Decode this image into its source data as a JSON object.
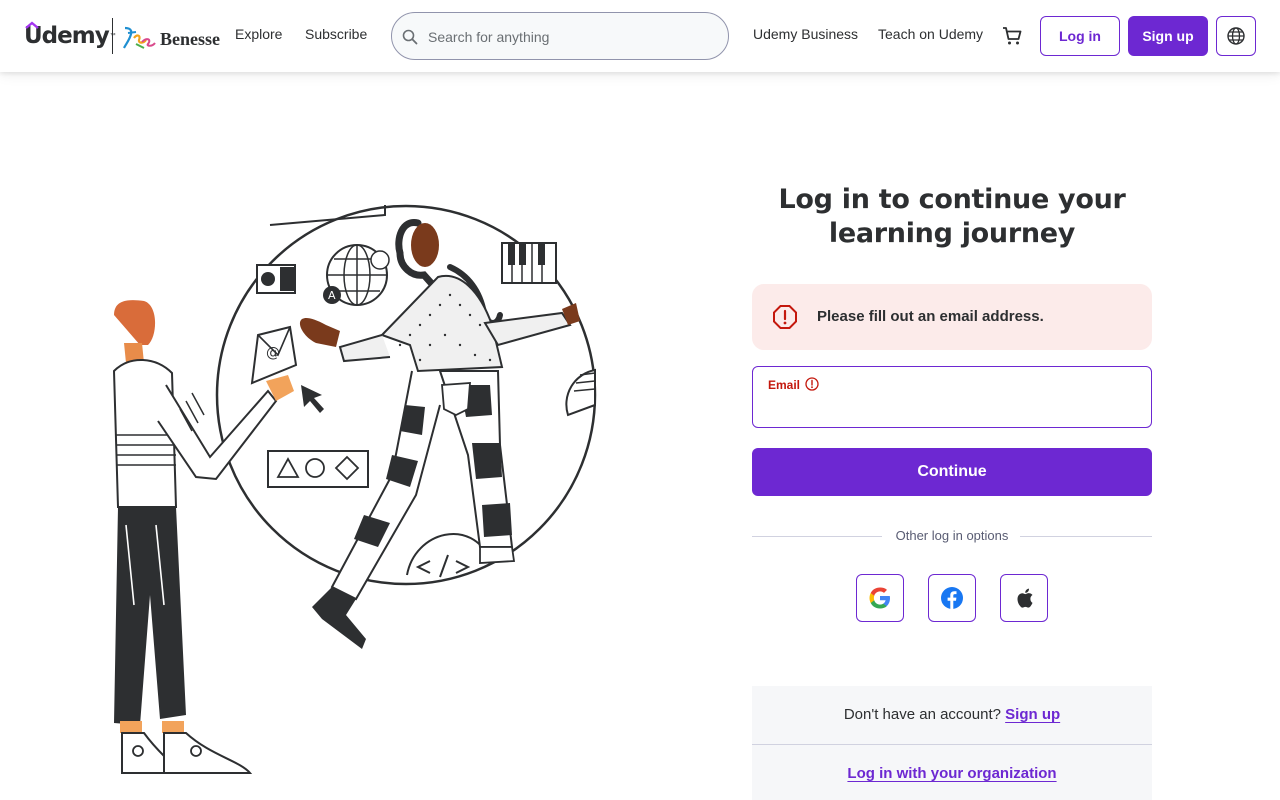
{
  "header": {
    "brand": "Udemy",
    "trademark": "™",
    "partner_brand": "Benesse",
    "nav": {
      "explore": "Explore",
      "subscribe": "Subscribe",
      "business": "Udemy Business",
      "teach": "Teach on Udemy"
    },
    "search": {
      "placeholder": "Search for anything",
      "value": ""
    },
    "login_label": "Log in",
    "signup_label": "Sign up",
    "icons": {
      "search": "search-icon",
      "cart": "cart-icon",
      "language": "globe-icon"
    }
  },
  "login": {
    "title_line1": "Log in to continue your",
    "title_line2": "learning journey",
    "alert_message": "Please fill out an email address.",
    "email_label": "Email",
    "email_value": "",
    "continue_label": "Continue",
    "other_options_label": "Other log in options",
    "social_providers": [
      "google",
      "facebook",
      "apple"
    ],
    "no_account_text": "Don't have an account?",
    "signup_link": "Sign up",
    "org_link": "Log in with your organization"
  },
  "colors": {
    "accent": "#6d28d2",
    "error": "#c4180d",
    "alert_bg": "#fcebea",
    "text": "#2d2f31"
  }
}
